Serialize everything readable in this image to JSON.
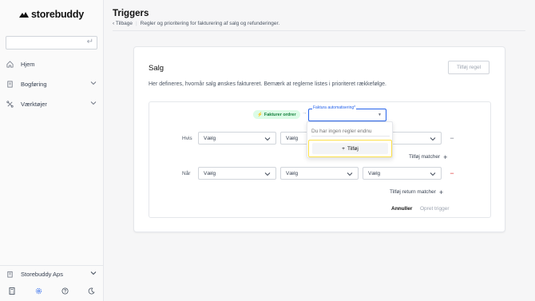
{
  "app": {
    "brand": "storebuddy"
  },
  "sidebar": {
    "search": {
      "value": "",
      "placeholder": ""
    },
    "items": [
      {
        "label": "Hjem",
        "icon": "home-icon"
      },
      {
        "label": "Bogføring",
        "icon": "ledger-icon"
      },
      {
        "label": "Værktøjer",
        "icon": "tools-icon"
      }
    ],
    "org": {
      "label": "Storebuddy Aps",
      "icon": "building-icon"
    },
    "footer_icons": [
      "calculator-icon",
      "gear-icon",
      "help-icon",
      "moon-icon"
    ]
  },
  "header": {
    "title": "Triggers",
    "back_label": "Tilbage",
    "description": "Regler og prioritering for fakturering af salg og refunderinger."
  },
  "card": {
    "title": "Salg",
    "description": "Her defineres, hvornår salg ønskes faktureret. Bemærk at reglerne listes i prioriteret rækkefølge.",
    "add_rule_label": "Tilføj regel",
    "trigger": {
      "badge_label": "Fakturer ordrer",
      "select_label": "Faktura automatisering*",
      "select_value": ""
    },
    "if_row": {
      "label": "Hvis",
      "selects": [
        "Vælg",
        "Vælg",
        ""
      ],
      "add_matcher_label": "Tilføj matcher"
    },
    "when_row": {
      "label": "Når",
      "selects": [
        "Vælg",
        "Vælg",
        "Vælg"
      ],
      "add_return_matcher_label": "Tilføj return matcher"
    },
    "cancel_label": "Annuller",
    "create_label": "Opret trigger"
  },
  "dropdown": {
    "empty_placeholder": "Du har ingen regler endnu",
    "add_label": "Tilføj"
  },
  "colors": {
    "accent": "#2563eb",
    "badge_bg": "#dcfce7",
    "badge_text": "#15803d",
    "remove_red": "#dc2626",
    "highlight": "#fde047"
  }
}
